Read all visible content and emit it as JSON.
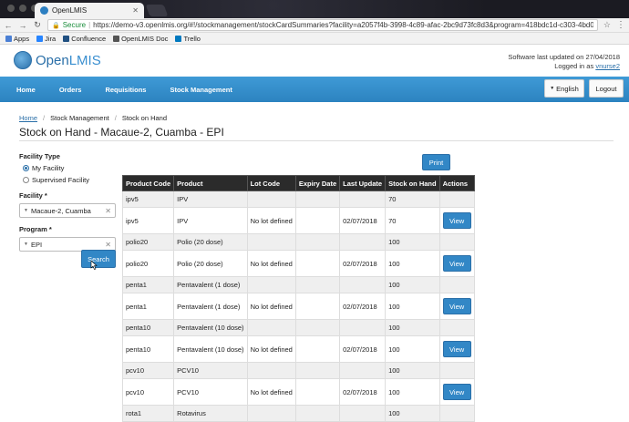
{
  "browser": {
    "tab_title": "OpenLMIS",
    "secure_label": "Secure",
    "url": "https://demo-v3.openlmis.org/#!/stockmanagement/stockCardSummaries?facility=a2057f4b-3998-4c89-afac-2bc9d73fc8d3&program=418bdc1d-c303-4bd0-b2d3-d89011...",
    "bookmarks": [
      "Apps",
      "Jira",
      "Confluence",
      "OpenLMIS Doc",
      "Trello"
    ]
  },
  "header": {
    "logo_prefix": "Open",
    "logo_suffix": "LMIS",
    "updated_text": "Software last updated on 27/04/2018",
    "logged_in_prefix": "Logged in as",
    "username": "vnurse2"
  },
  "nav": {
    "items": [
      "Home",
      "Orders",
      "Requisitions",
      "Stock Management"
    ],
    "language": "English",
    "logout": "Logout"
  },
  "breadcrumb": [
    "Home",
    "Stock Management",
    "Stock on Hand"
  ],
  "page_title": "Stock on Hand - Macaue-2, Cuamba - EPI",
  "form": {
    "facility_type_label": "Facility Type",
    "my_facility": "My Facility",
    "supervised_facility": "Supervised Facility",
    "facility_label": "Facility *",
    "facility_value": "Macaue-2, Cuamba",
    "program_label": "Program *",
    "program_value": "EPI",
    "search": "Search",
    "print": "Print"
  },
  "table": {
    "headers": [
      "Product Code",
      "Product",
      "Lot Code",
      "Expiry Date",
      "Last Update",
      "Stock on Hand",
      "Actions"
    ],
    "view_label": "View",
    "rows": [
      {
        "code": "ipv5",
        "product": "IPV",
        "lot": "",
        "expiry": "",
        "update": "",
        "soh": "70",
        "summary": true
      },
      {
        "code": "ipv5",
        "product": "IPV",
        "lot": "No lot defined",
        "expiry": "",
        "update": "02/07/2018",
        "soh": "70",
        "summary": false
      },
      {
        "code": "polio20",
        "product": "Polio (20 dose)",
        "lot": "",
        "expiry": "",
        "update": "",
        "soh": "100",
        "summary": true
      },
      {
        "code": "polio20",
        "product": "Polio (20 dose)",
        "lot": "No lot defined",
        "expiry": "",
        "update": "02/07/2018",
        "soh": "100",
        "summary": false
      },
      {
        "code": "penta1",
        "product": "Pentavalent (1 dose)",
        "lot": "",
        "expiry": "",
        "update": "",
        "soh": "100",
        "summary": true
      },
      {
        "code": "penta1",
        "product": "Pentavalent (1 dose)",
        "lot": "No lot defined",
        "expiry": "",
        "update": "02/07/2018",
        "soh": "100",
        "summary": false
      },
      {
        "code": "penta10",
        "product": "Pentavalent (10 dose)",
        "lot": "",
        "expiry": "",
        "update": "",
        "soh": "100",
        "summary": true
      },
      {
        "code": "penta10",
        "product": "Pentavalent (10 dose)",
        "lot": "No lot defined",
        "expiry": "",
        "update": "02/07/2018",
        "soh": "100",
        "summary": false
      },
      {
        "code": "pcv10",
        "product": "PCV10",
        "lot": "",
        "expiry": "",
        "update": "",
        "soh": "100",
        "summary": true
      },
      {
        "code": "pcv10",
        "product": "PCV10",
        "lot": "No lot defined",
        "expiry": "",
        "update": "02/07/2018",
        "soh": "100",
        "summary": false
      },
      {
        "code": "rota1",
        "product": "Rotavirus",
        "lot": "",
        "expiry": "",
        "update": "",
        "soh": "100",
        "summary": true
      }
    ]
  }
}
